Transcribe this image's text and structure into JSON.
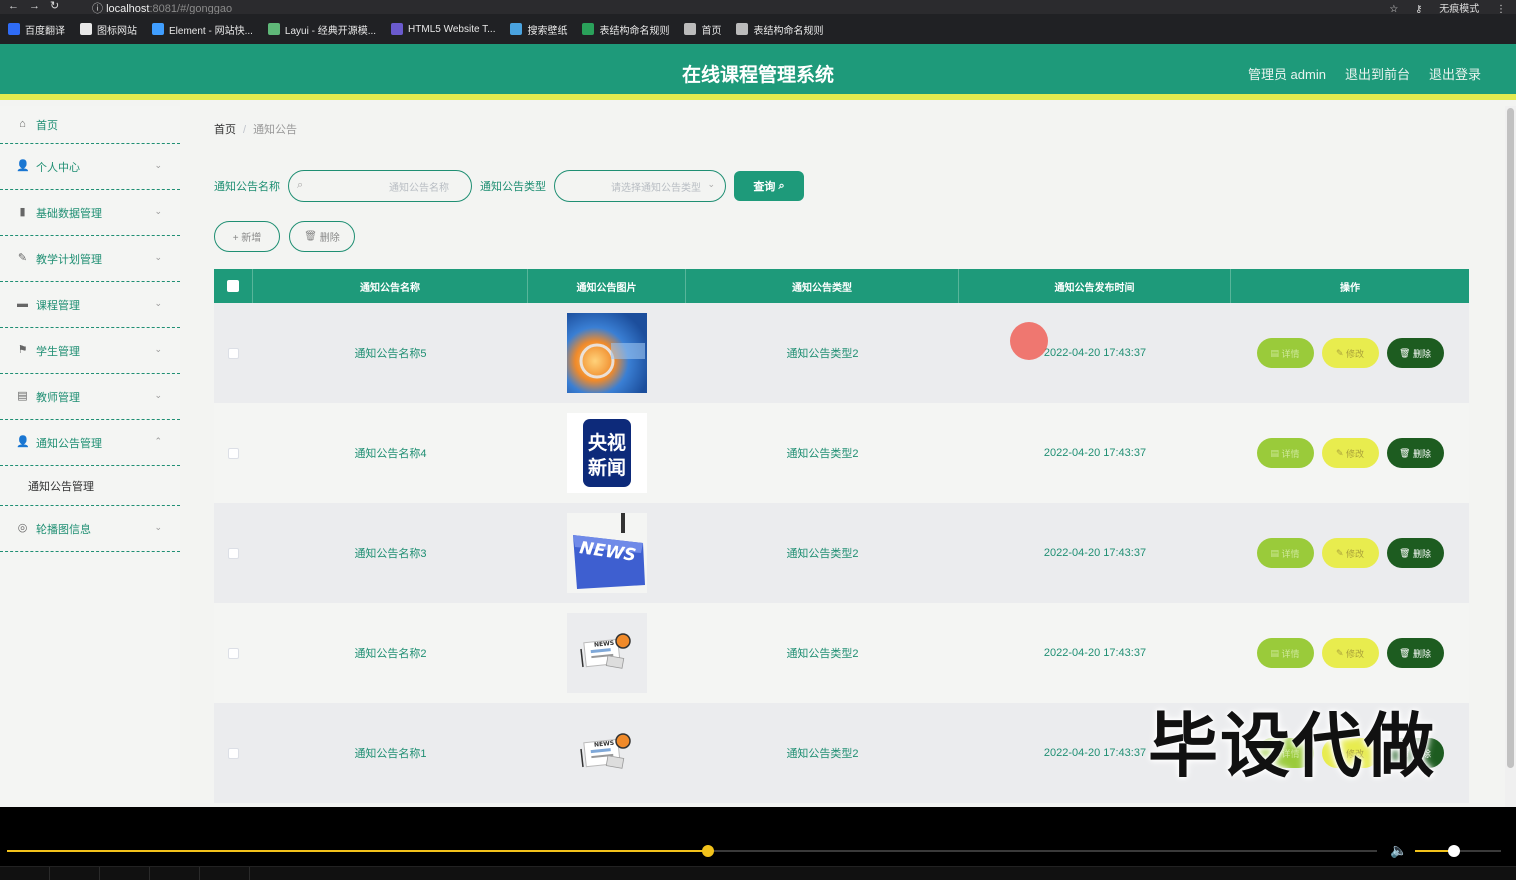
{
  "browser": {
    "url_host": "localhost",
    "url_path": ":8081/#/gonggao",
    "incognito_label": "无痕模式",
    "bookmarks": [
      {
        "label": "百度翻译",
        "color": "#2f6cf6"
      },
      {
        "label": "图标网站",
        "color": "#e8e8e8"
      },
      {
        "label": "Element - 网站快...",
        "color": "#409eff"
      },
      {
        "label": "Layui - 经典开源模...",
        "color": "#5fb878"
      },
      {
        "label": "HTML5 Website T...",
        "color": "#6a5acd"
      },
      {
        "label": "搜索壁纸",
        "color": "#4aa3df"
      },
      {
        "label": "表结构命名规则",
        "color": "#2aa15a"
      },
      {
        "label": "首页",
        "color": "#bbbbbb"
      },
      {
        "label": "表结构命名规则",
        "color": "#bbbbbb"
      }
    ]
  },
  "header": {
    "title": "在线课程管理系统",
    "admin": "管理员 admin",
    "exit_front": "退出到前台",
    "logout": "退出登录"
  },
  "sidebar": {
    "items": [
      {
        "label": "首页",
        "icon": "home-icon",
        "glyph": "⌂"
      },
      {
        "label": "个人中心",
        "icon": "user-icon",
        "glyph": "👤"
      },
      {
        "label": "基础数据管理",
        "icon": "bar-chart-icon",
        "glyph": "▮"
      },
      {
        "label": "教学计划管理",
        "icon": "pen-icon",
        "glyph": "✎"
      },
      {
        "label": "课程管理",
        "icon": "briefcase-icon",
        "glyph": "▬"
      },
      {
        "label": "学生管理",
        "icon": "flag-icon",
        "glyph": "⚑"
      },
      {
        "label": "教师管理",
        "icon": "clipboard-icon",
        "glyph": "▤"
      },
      {
        "label": "通知公告管理",
        "icon": "user-icon",
        "glyph": "👤"
      },
      {
        "label": "轮播图信息",
        "icon": "compass-icon",
        "glyph": "◎"
      }
    ],
    "submenu_label": "通知公告管理"
  },
  "breadcrumb": {
    "home": "首页",
    "separator": "/",
    "current": "通知公告"
  },
  "search": {
    "name_label": "通知公告名称",
    "name_placeholder": "通知公告名称",
    "type_label": "通知公告类型",
    "type_placeholder": "请选择通知公告类型",
    "query_button": "查询"
  },
  "actions": {
    "add": "+ 新增",
    "delete": "删除"
  },
  "table": {
    "columns": [
      "通知公告名称",
      "通知公告图片",
      "通知公告类型",
      "通知公告发布时间",
      "操作"
    ],
    "rows": [
      {
        "name": "通知公告名称5",
        "image": "news-blue",
        "type": "通知公告类型2",
        "time": "2022-04-20 17:43:37"
      },
      {
        "name": "通知公告名称4",
        "image": "cctv-news",
        "type": "通知公告类型2",
        "time": "2022-04-20 17:43:37"
      },
      {
        "name": "通知公告名称3",
        "image": "news-key",
        "type": "通知公告类型2",
        "time": "2022-04-20 17:43:37"
      },
      {
        "name": "通知公告名称2",
        "image": "news-paper",
        "type": "通知公告类型2",
        "time": "2022-04-20 17:43:37"
      },
      {
        "name": "通知公告名称1",
        "image": "news-paper",
        "type": "通知公告类型2",
        "time": "2022-04-20 17:43:37"
      }
    ],
    "op_detail": "详情",
    "op_edit": "修改",
    "op_delete": "删除"
  },
  "image_text": {
    "cctv_line1": "央视",
    "cctv_line2": "新闻",
    "news_key": "NEWS",
    "news_small": "NEWS"
  },
  "watermark": "毕设代做",
  "player": {
    "progress": 0.512,
    "volume": 0.45
  },
  "colors": {
    "primary": "#1e9a7a",
    "accent": "#e3ea4f",
    "detail": "#9acb3a",
    "edit": "#e8ec4e",
    "delete": "#1d5c20"
  }
}
